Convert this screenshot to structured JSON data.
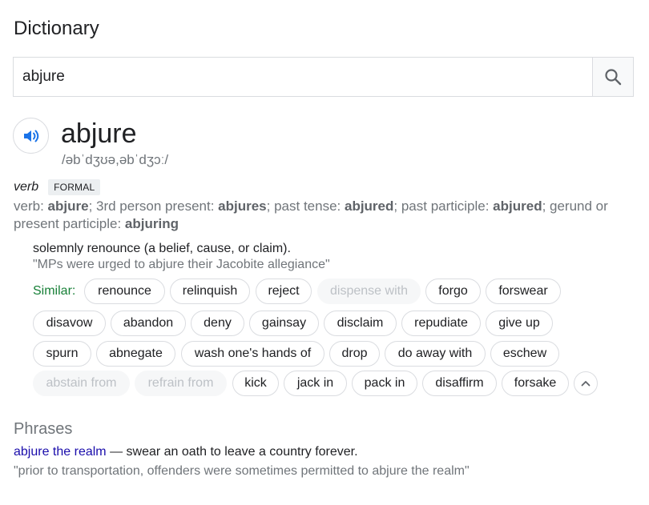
{
  "header": {
    "title": "Dictionary"
  },
  "search": {
    "value": "abjure",
    "icon": "search-icon"
  },
  "entry": {
    "speaker_icon": "speaker-icon",
    "word": "abjure",
    "pronunciation": "/əbˈdʒʊə,əbˈdʒɔː/",
    "part_of_speech": "verb",
    "register": "FORMAL",
    "forms": {
      "p1": "verb: ",
      "b1": "abjure",
      "p2": "; 3rd person present: ",
      "b2": "abjures",
      "p3": "; past tense: ",
      "b3": "abjured",
      "p4": "; past participle: ",
      "b4": "abjured",
      "p5": "; gerund or present participle: ",
      "b5": "abjuring"
    },
    "definition": "solemnly renounce (a belief, cause, or claim).",
    "example": "\"MPs were urged to abjure their Jacobite allegiance\"",
    "similar_label": "Similar:",
    "similar": [
      {
        "label": "renounce",
        "dim": false
      },
      {
        "label": "relinquish",
        "dim": false
      },
      {
        "label": "reject",
        "dim": false
      },
      {
        "label": "dispense with",
        "dim": true
      },
      {
        "label": "forgo",
        "dim": false
      },
      {
        "label": "forswear",
        "dim": false
      },
      {
        "label": "disavow",
        "dim": false
      },
      {
        "label": "abandon",
        "dim": false
      },
      {
        "label": "deny",
        "dim": false
      },
      {
        "label": "gainsay",
        "dim": false
      },
      {
        "label": "disclaim",
        "dim": false
      },
      {
        "label": "repudiate",
        "dim": false
      },
      {
        "label": "give up",
        "dim": false
      },
      {
        "label": "spurn",
        "dim": false
      },
      {
        "label": "abnegate",
        "dim": false
      },
      {
        "label": "wash one's hands of",
        "dim": false
      },
      {
        "label": "drop",
        "dim": false
      },
      {
        "label": "do away with",
        "dim": false
      },
      {
        "label": "eschew",
        "dim": false
      },
      {
        "label": "abstain from",
        "dim": true
      },
      {
        "label": "refrain from",
        "dim": true
      },
      {
        "label": "kick",
        "dim": false
      },
      {
        "label": "jack in",
        "dim": false
      },
      {
        "label": "pack in",
        "dim": false
      },
      {
        "label": "disaffirm",
        "dim": false
      },
      {
        "label": "forsake",
        "dim": false
      }
    ],
    "collapse_icon": "chevron-up-icon"
  },
  "phrases": {
    "heading": "Phrases",
    "items": [
      {
        "phrase": "abjure the realm",
        "meaning": " — swear an oath to leave a country forever.",
        "example": "\"prior to transportation, offenders were sometimes permitted to abjure the realm\""
      }
    ]
  },
  "colors": {
    "similar_label": "#188038",
    "link": "#1a0dab",
    "speaker": "#1a73e8",
    "muted": "#70757a"
  }
}
